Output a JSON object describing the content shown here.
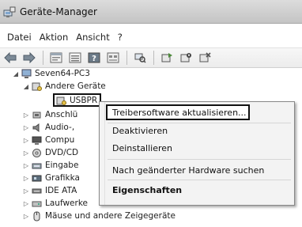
{
  "window": {
    "title": "Geräte-Manager"
  },
  "menu": [
    "Datei",
    "Aktion",
    "Ansicht",
    "?"
  ],
  "toolbar": {
    "icons": [
      "back-arrow-icon",
      "forward-arrow-icon",
      "properties-icon",
      "list-icon",
      "help-icon",
      "view-icon",
      "scan-hardware-icon",
      "update-driver-icon",
      "disable-device-icon",
      "uninstall-icon"
    ]
  },
  "tree": {
    "root": "Seven64-PC3",
    "other_devices": "Andere Geräte",
    "usb_item": "USBPR",
    "categories": [
      "Anschlü",
      "Audio-,",
      "Compu",
      "DVD/CD",
      "Eingabe",
      "Grafikka",
      "IDE ATA",
      "Laufwerke",
      "Mäuse und andere Zeigegeräte"
    ]
  },
  "context_menu": {
    "update": "Treibersoftware aktualisieren...",
    "disable": "Deaktivieren",
    "uninstall": "Deinstallieren",
    "scan": "Nach geänderter Hardware suchen",
    "properties": "Eigenschaften"
  }
}
